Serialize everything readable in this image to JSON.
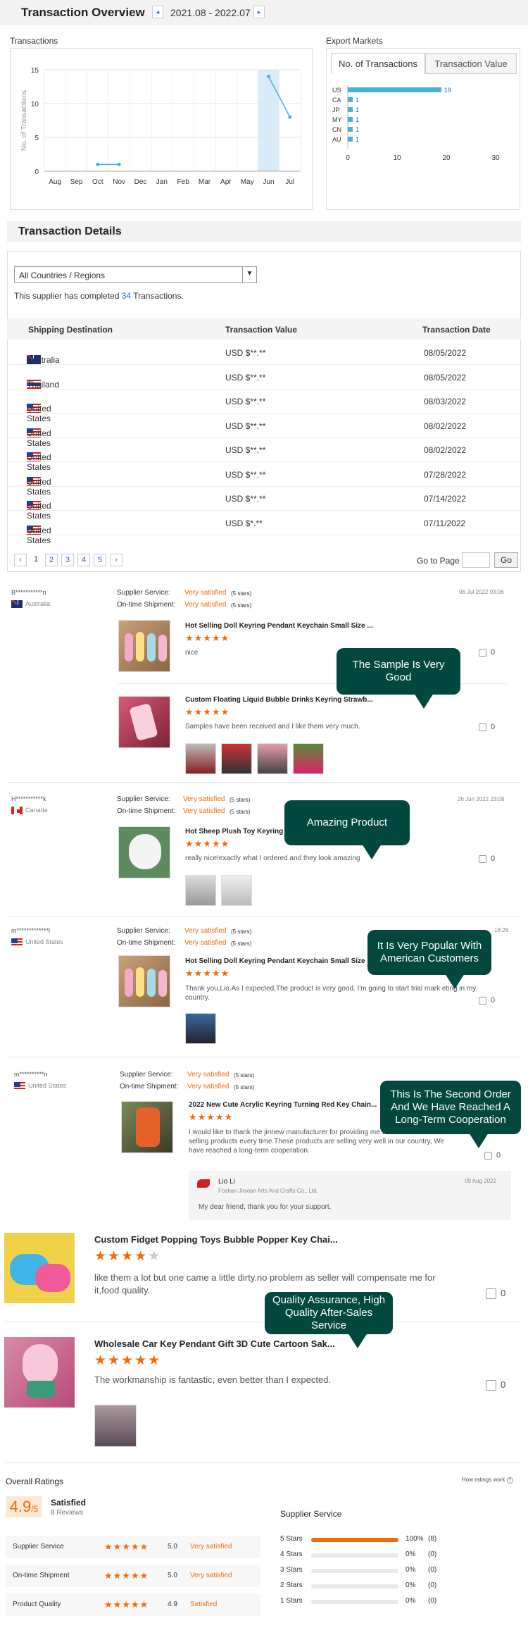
{
  "header": {
    "title": "Transaction Overview",
    "date_range": "2021.08 - 2022.07",
    "prev": "◂",
    "next": "▸"
  },
  "transactions_panel": {
    "title": "Transactions"
  },
  "export_panel": {
    "title": "Export Markets",
    "tab_active": "No. of Transactions",
    "tab_inactive": "Transaction Value"
  },
  "chart_data": [
    {
      "type": "line",
      "title": "",
      "ylabel": "No. of Transactions",
      "xlabel": "",
      "categories": [
        "Aug",
        "Sep",
        "Oct",
        "Nov",
        "Dec",
        "Jan",
        "Feb",
        "Mar",
        "Apr",
        "May",
        "Jun",
        "Jul"
      ],
      "series": [
        {
          "values": [
            null,
            null,
            1,
            1,
            null,
            null,
            null,
            null,
            null,
            null,
            14,
            8
          ]
        }
      ],
      "ylim": [
        0,
        15
      ],
      "yticks": [
        0,
        5,
        10,
        15
      ],
      "highlight_category": "Jun",
      "grid": true
    },
    {
      "type": "bar",
      "orientation": "horizontal",
      "categories": [
        "US",
        "CA",
        "JP",
        "MY",
        "CN",
        "AU"
      ],
      "values": [
        19,
        1,
        1,
        1,
        1,
        1
      ],
      "xlim": [
        0,
        30
      ],
      "xticks": [
        0,
        10,
        20,
        30
      ],
      "color": "#4aaee6"
    }
  ],
  "details": {
    "title": "Transaction Details",
    "filter": "All Countries / Regions",
    "summary_pre": "This supplier has completed ",
    "summary_count": "34",
    "summary_post": " Transactions.",
    "headers": [
      "Shipping Destination",
      "Transaction Value",
      "Transaction Date"
    ],
    "rows": [
      {
        "flag": "au",
        "country": "Australia",
        "value": "USD $**.**",
        "date": "08/05/2022"
      },
      {
        "flag": "th",
        "country": "Thailand",
        "value": "USD $**.**",
        "date": "08/05/2022"
      },
      {
        "flag": "us",
        "country": "United States",
        "value": "USD $**.**",
        "date": "08/03/2022"
      },
      {
        "flag": "us",
        "country": "United States",
        "value": "USD $**.**",
        "date": "08/02/2022"
      },
      {
        "flag": "us",
        "country": "United States",
        "value": "USD $**.**",
        "date": "08/02/2022"
      },
      {
        "flag": "us",
        "country": "United States",
        "value": "USD $**.**",
        "date": "07/28/2022"
      },
      {
        "flag": "us",
        "country": "United States",
        "value": "USD $**.**",
        "date": "07/14/2022"
      },
      {
        "flag": "us",
        "country": "United States",
        "value": "USD $*.**",
        "date": "07/11/2022"
      }
    ],
    "pager": {
      "pages": [
        "1",
        "2",
        "3",
        "4",
        "5"
      ],
      "goto_label": "Go to Page",
      "go": "Go",
      "prev": "‹",
      "next": "›"
    }
  },
  "labels": {
    "supplier_service": "Supplier Service:",
    "on_time": "On-time Shipment:",
    "very_satisfied": "Very satisfied",
    "five_stars": "(5 stars)",
    "stars": "★★★★★",
    "stars4": "★★★★",
    "star_empty": "★"
  },
  "reviews": [
    {
      "user": "B***********n",
      "country": "Australia",
      "date": "06 Jul 2022 03:06",
      "products": [
        {
          "title": "Hot Selling Doll Keyring Pendant Keychain Small Size ...",
          "text": "nice",
          "likes": "0"
        },
        {
          "title": "Custom Floating Liquid Bubble Drinks Keyring Strawb...",
          "text": "Samples have been received and I like them very much.",
          "likes": "0"
        }
      ]
    },
    {
      "user": "H***********k",
      "country": "Canada",
      "date": "26 Jun 2022 23:08",
      "products": [
        {
          "title": "Hot Sheep Plush Toy Keyring S",
          "text": "really nice!exactly what I ordered and they look amazing",
          "likes": "0"
        }
      ]
    },
    {
      "user": "m*************l",
      "country": "United States",
      "date": "18:28",
      "products": [
        {
          "title": "Hot Selling Doll Keyring Pendant Keychain Small Size ...",
          "text": "Thank you,Lio.As I expected,The product is very good. I'm going to start trial mark eting in my country.",
          "likes": "0"
        }
      ]
    },
    {
      "user": "m**********n",
      "country": "United States",
      "products": [
        {
          "title": "2022 New Cute Acrylic Keyring Turning Red Key Chain...",
          "text": "I would like to thank the jinnew manufacturer for providing me with the latest hot-selling products every time.These products are selling very well in our country, We have reached a long-term cooperation.",
          "likes": "0"
        }
      ],
      "reply": {
        "name": "Lio Li",
        "company": "Foshan Jinxian Arts And Crafts Co., Ltd.",
        "date": "09 Aug 2022",
        "text": "My dear friend, thank you for your support."
      }
    }
  ],
  "large_reviews": [
    {
      "title": "Custom Fidget Popping Toys Bubble Popper Key Chai...",
      "text": "like them a lot but one came a little dirty.no problem as seller will compensate me for it,food quality.",
      "likes": "0"
    },
    {
      "title": "Wholesale Car Key Pendant Gift 3D Cute Cartoon Sak...",
      "text": "The workmanship is fantastic, even better than I expected.",
      "likes": "0"
    }
  ],
  "bubbles": [
    "The Sample Is Very Good",
    "Amazing Product",
    "It Is Very Popular With American Customers",
    "This Is The Second Order And We Have Reached A Long-Term Cooperation",
    "Quality Assurance, High Quality After-Sales Service"
  ],
  "overall": {
    "title": "Overall Ratings",
    "how": "How ratings work",
    "score": "4.9",
    "score_suffix": "/5",
    "label": "Satisfied",
    "count": "8 Reviews",
    "rows": [
      {
        "label": "Supplier Service",
        "score": "5.0",
        "text": "Very satisfied"
      },
      {
        "label": "On-time Shipment",
        "score": "5.0",
        "text": "Very satisfied"
      },
      {
        "label": "Product Quality",
        "score": "4.9",
        "text": "Satisfied"
      }
    ],
    "dist_title": "Supplier Service",
    "dist": [
      {
        "label": "5 Stars",
        "pct": "100%",
        "count": "(8)",
        "fill": 1.0
      },
      {
        "label": "4 Stars",
        "pct": "0%",
        "count": "(0)",
        "fill": 0
      },
      {
        "label": "3 Stars",
        "pct": "0%",
        "count": "(0)",
        "fill": 0
      },
      {
        "label": "2 Stars",
        "pct": "0%",
        "count": "(0)",
        "fill": 0
      },
      {
        "label": "1 Stars",
        "pct": "0%",
        "count": "(0)",
        "fill": 0
      }
    ]
  }
}
